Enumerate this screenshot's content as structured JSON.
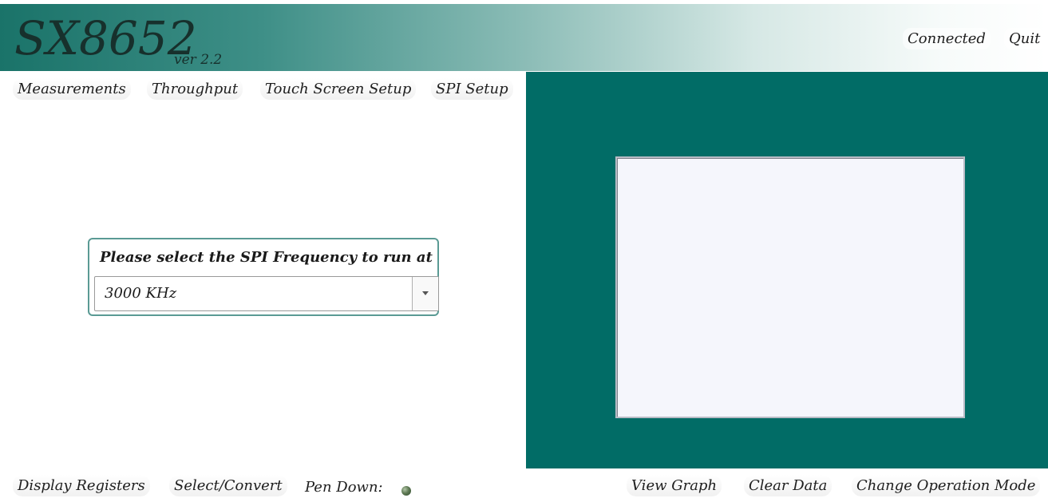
{
  "app": {
    "title": "SX8652",
    "version": "ver 2.2"
  },
  "header": {
    "connected_label": "Connected",
    "quit_label": "Quit"
  },
  "nav": {
    "items": [
      {
        "label": "Measurements"
      },
      {
        "label": "Throughput"
      },
      {
        "label": "Touch Screen Setup"
      },
      {
        "label": "SPI Setup"
      }
    ]
  },
  "spi_setup": {
    "prompt": "Please select the SPI Frequency to run at",
    "selected_frequency": "3000 KHz"
  },
  "footer": {
    "display_registers_label": "Display Registers",
    "select_convert_label": "Select/Convert",
    "pen_down_label": "Pen Down:",
    "pen_down_icon": "led-indicator-icon",
    "view_graph_label": "View Graph",
    "clear_data_label": "Clear Data",
    "change_mode_label": "Change Operation Mode"
  },
  "colors": {
    "panel_teal": "#016c66",
    "header_gradient_start": "#1a7369",
    "touch_area": "#f5f6fc",
    "pen_led": "#5f7a55"
  }
}
